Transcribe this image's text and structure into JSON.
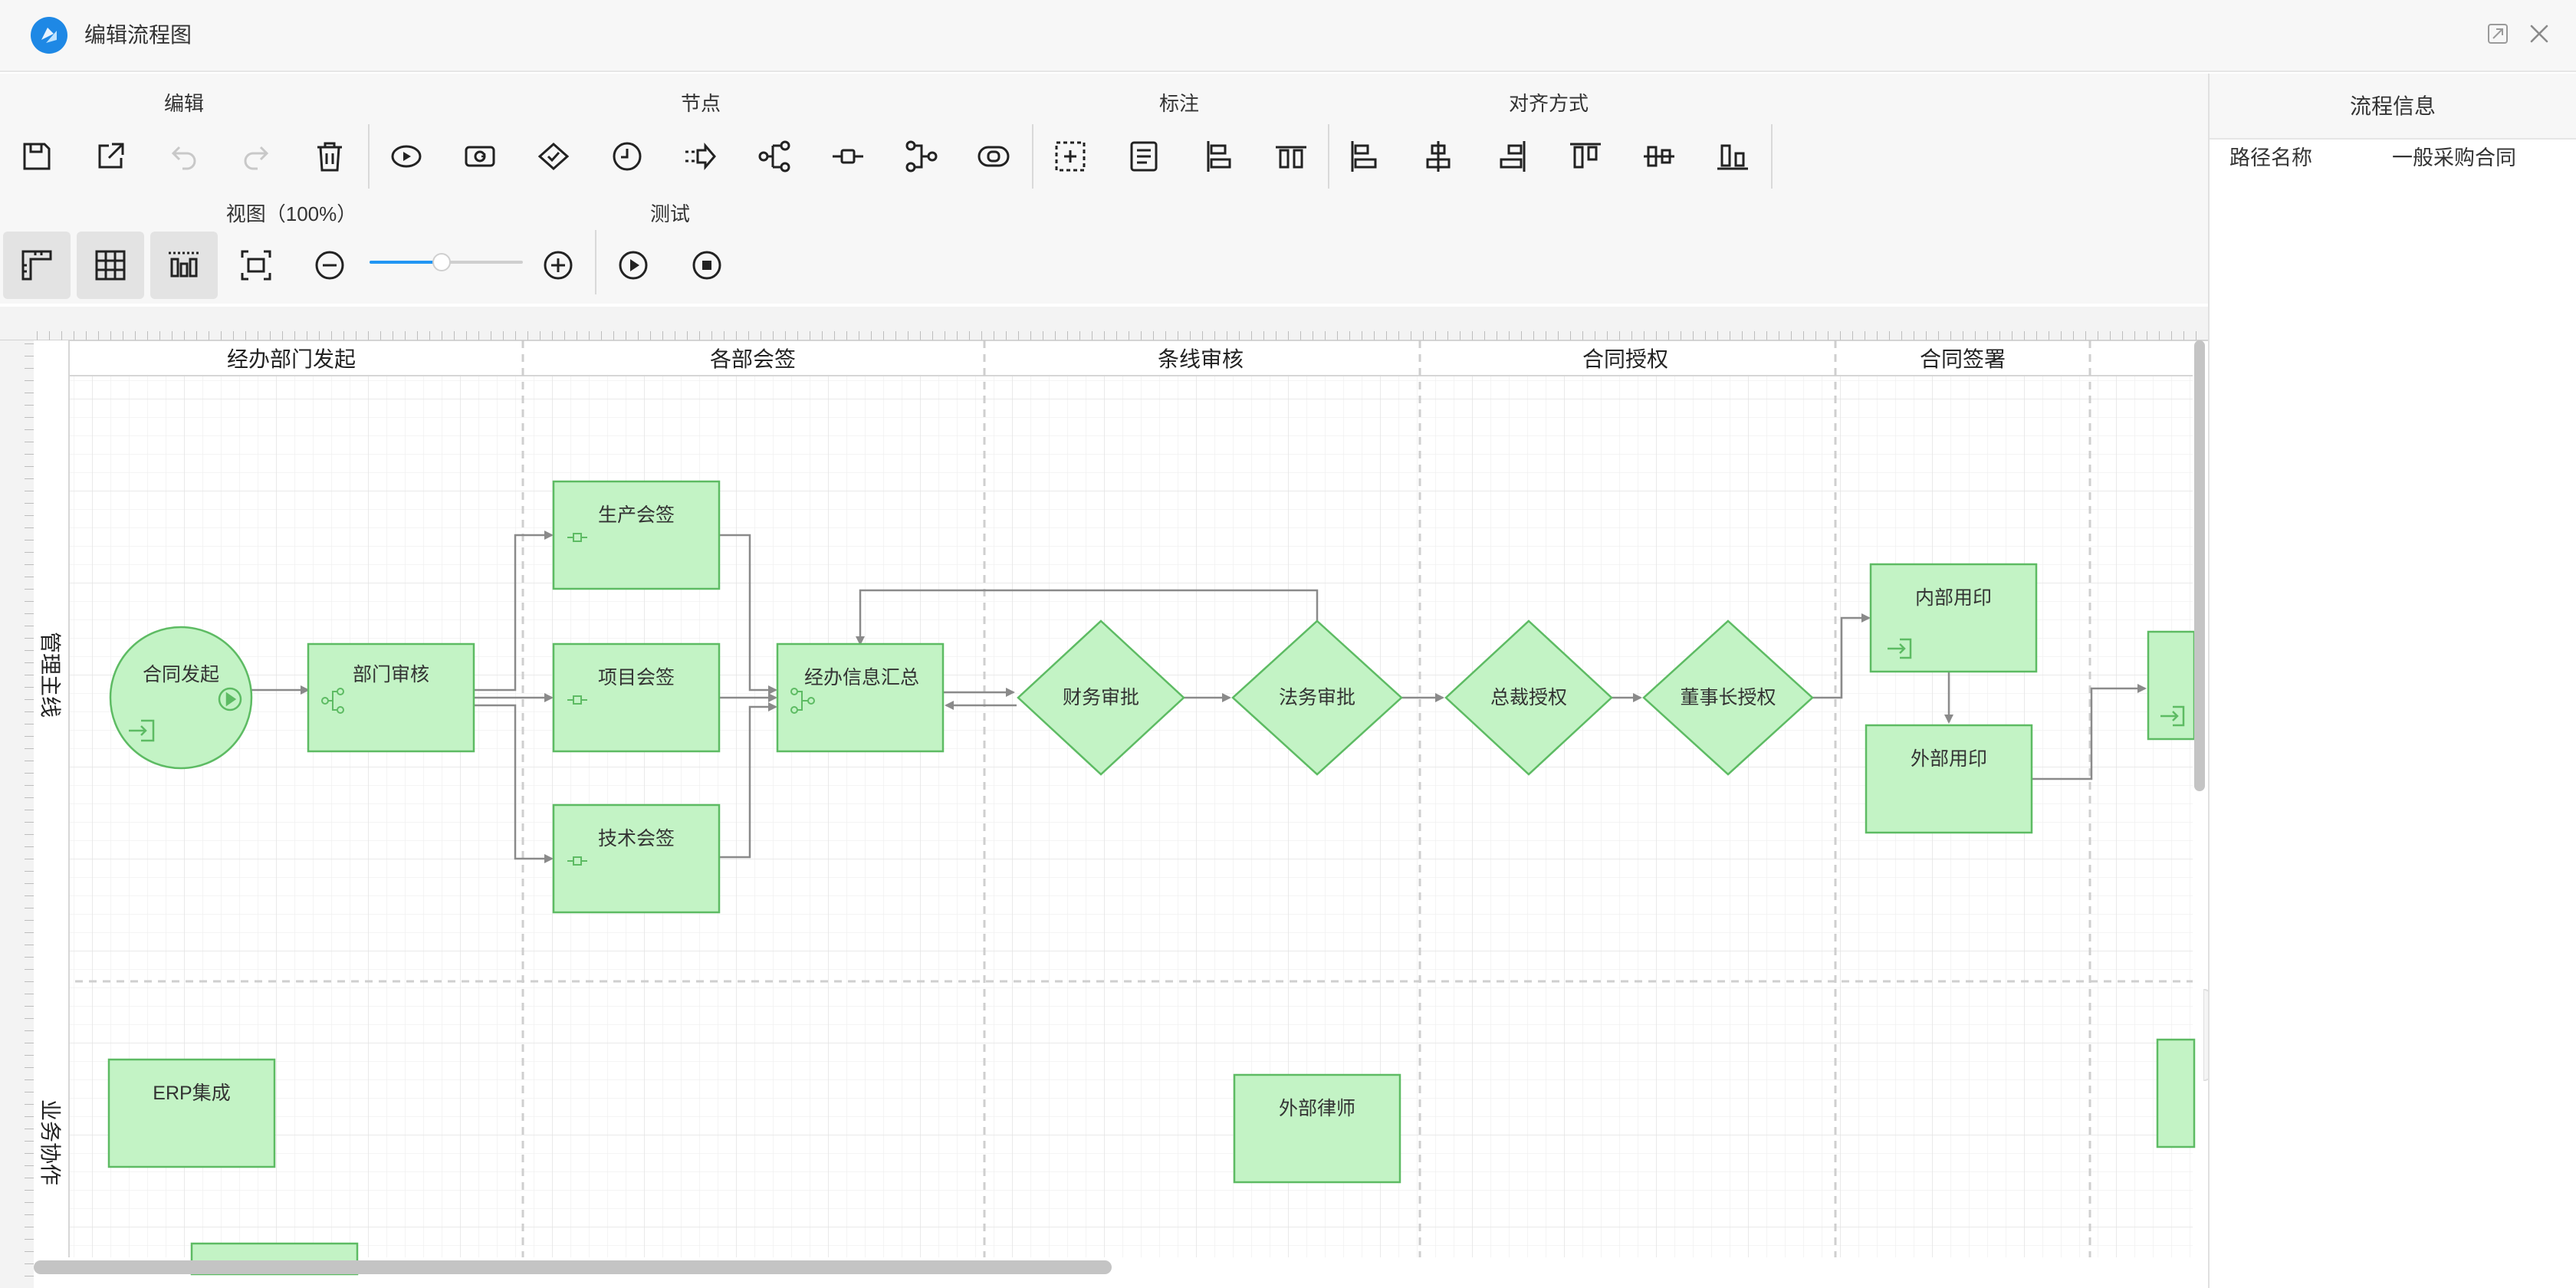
{
  "window": {
    "title": "编辑流程图",
    "logo_icon": "app-logo-icon",
    "restore_icon": "restore-icon",
    "close_icon": "close-icon"
  },
  "toolbar": {
    "groups": {
      "edit": "编辑",
      "node": "节点",
      "annotation": "标注",
      "align": "对齐方式",
      "view": "视图（100%）",
      "test": "测试"
    },
    "zoom_percent": 100,
    "zoom_slider_fraction": 0.47,
    "buttons": [
      {
        "name": "save",
        "icon": "save-icon",
        "enabled": true
      },
      {
        "name": "export",
        "icon": "export-icon",
        "enabled": true
      },
      {
        "name": "undo",
        "icon": "undo-icon",
        "enabled": false
      },
      {
        "name": "redo",
        "icon": "redo-icon",
        "enabled": false
      },
      {
        "name": "delete",
        "icon": "trash-icon",
        "enabled": true
      },
      {
        "name": "start-node",
        "icon": "start-node-icon",
        "enabled": true
      },
      {
        "name": "subprocess-node",
        "icon": "subprocess-node-icon",
        "enabled": true
      },
      {
        "name": "decision-node",
        "icon": "decision-node-icon",
        "enabled": true
      },
      {
        "name": "timer-node",
        "icon": "timer-node-icon",
        "enabled": true
      },
      {
        "name": "transfer-node",
        "icon": "transfer-node-icon",
        "enabled": true
      },
      {
        "name": "branch-node",
        "icon": "branch-node-icon",
        "enabled": true
      },
      {
        "name": "activity-node",
        "icon": "activity-node-icon",
        "enabled": true
      },
      {
        "name": "merge-node",
        "icon": "merge-node-icon",
        "enabled": true
      },
      {
        "name": "end-node",
        "icon": "end-node-icon",
        "enabled": true
      },
      {
        "name": "group-annotation",
        "icon": "group-select-icon",
        "enabled": true
      },
      {
        "name": "text-annotation",
        "icon": "text-annotation-icon",
        "enabled": true
      },
      {
        "name": "vertical-lane",
        "icon": "vertical-lane-icon",
        "enabled": true
      },
      {
        "name": "horizontal-lane",
        "icon": "horizontal-lane-icon",
        "enabled": true
      },
      {
        "name": "align-left",
        "icon": "align-left-icon",
        "enabled": true
      },
      {
        "name": "align-center",
        "icon": "align-center-icon",
        "enabled": true
      },
      {
        "name": "align-right",
        "icon": "align-right-icon",
        "enabled": true
      },
      {
        "name": "align-top",
        "icon": "align-top-icon",
        "enabled": true
      },
      {
        "name": "align-middle",
        "icon": "align-middle-icon",
        "enabled": true
      },
      {
        "name": "align-bottom",
        "icon": "align-bottom-icon",
        "enabled": true
      },
      {
        "name": "ruler-toggle",
        "icon": "ruler-icon",
        "enabled": true,
        "active": true
      },
      {
        "name": "grid-toggle",
        "icon": "grid-icon",
        "enabled": true,
        "active": true
      },
      {
        "name": "guides-toggle",
        "icon": "guides-icon",
        "enabled": true,
        "active": true
      },
      {
        "name": "fit-view",
        "icon": "fit-view-icon",
        "enabled": true
      },
      {
        "name": "zoom-out",
        "icon": "zoom-out-icon",
        "enabled": true
      },
      {
        "name": "zoom-in",
        "icon": "zoom-in-icon",
        "enabled": true
      },
      {
        "name": "test-run",
        "icon": "play-icon",
        "enabled": true
      },
      {
        "name": "test-stop",
        "icon": "stop-icon",
        "enabled": true
      }
    ]
  },
  "info_panel": {
    "title": "流程信息",
    "path_name_label": "路径名称",
    "path_name_value": "一般采购合同"
  },
  "diagram": {
    "columns": [
      "经办部门发起",
      "各部会签",
      "条线审核",
      "合同授权",
      "合同签署"
    ],
    "lanes": [
      "管理主线",
      "业务协作"
    ],
    "nodes": [
      {
        "id": "n1",
        "label": "合同发起",
        "shape": "circle",
        "icon": "start-play-icon"
      },
      {
        "id": "n2",
        "label": "部门审核",
        "shape": "rect",
        "icon": "branch-icon"
      },
      {
        "id": "n3",
        "label": "生产会签",
        "shape": "rect",
        "icon": "activity-icon"
      },
      {
        "id": "n4",
        "label": "项目会签",
        "shape": "rect",
        "icon": "activity-icon"
      },
      {
        "id": "n5",
        "label": "技术会签",
        "shape": "rect",
        "icon": "activity-icon"
      },
      {
        "id": "n6",
        "label": "经办信息汇总",
        "shape": "rect",
        "icon": "merge-icon"
      },
      {
        "id": "n7",
        "label": "财务审批",
        "shape": "diamond"
      },
      {
        "id": "n8",
        "label": "法务审批",
        "shape": "diamond"
      },
      {
        "id": "n9",
        "label": "总裁授权",
        "shape": "diamond"
      },
      {
        "id": "n10",
        "label": "董事长授权",
        "shape": "diamond"
      },
      {
        "id": "n11",
        "label": "内部用印",
        "shape": "rect",
        "icon": "entry-icon"
      },
      {
        "id": "n12",
        "label": "外部用印",
        "shape": "rect"
      },
      {
        "id": "n13",
        "label": "ERP集成",
        "shape": "rect"
      },
      {
        "id": "n14",
        "label": "外部律师",
        "shape": "rect"
      }
    ],
    "colors": {
      "node_fill": "#c3f3c5",
      "node_stroke": "#5dbb63",
      "connector": "#8a8a8a",
      "grid": "#eeeeee",
      "lane_divider": "#cccccc",
      "accent": "#2196f3"
    }
  }
}
